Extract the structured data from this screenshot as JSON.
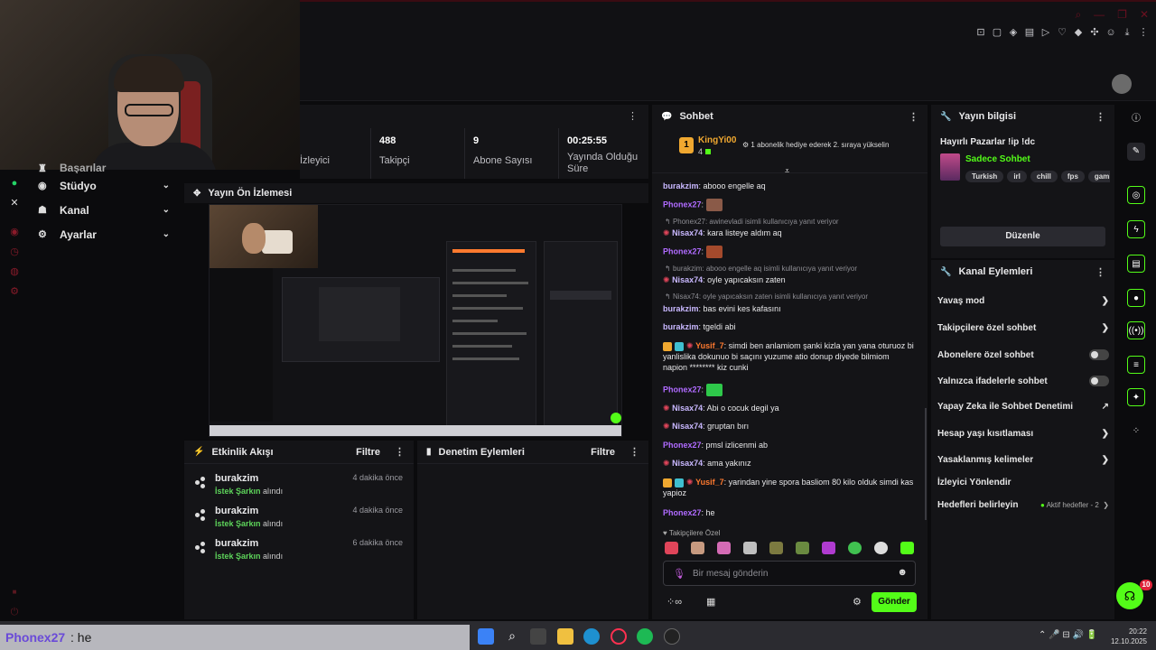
{
  "stats": [
    {
      "label": "İzleyici",
      "value": ""
    },
    {
      "label": "Takipçi",
      "value": "488"
    },
    {
      "label": "Abone Sayısı",
      "value": "9"
    },
    {
      "label": "Yayında Olduğu Süre",
      "value": "00:25:55"
    }
  ],
  "nav": {
    "partial_label": "Başarılar",
    "items": [
      {
        "label": "Stüdyo",
        "icon": "camera-icon"
      },
      {
        "label": "Kanal",
        "icon": "user-group-icon"
      },
      {
        "label": "Ayarlar",
        "icon": "gear-icon"
      }
    ]
  },
  "preview": {
    "title": "Yayın Ön İzlemesi"
  },
  "activity": {
    "title": "Etkinlik Akışı",
    "filter": "Filtre",
    "items": [
      {
        "user": "burakzim",
        "event": "İstek Şarkın",
        "suffix": "alındı",
        "time": "4 dakika önce"
      },
      {
        "user": "burakzim",
        "event": "İstek Şarkın",
        "suffix": "alındı",
        "time": "4 dakika önce"
      },
      {
        "user": "burakzim",
        "event": "İstek Şarkın",
        "suffix": "alındı",
        "time": "6 dakika önce"
      }
    ]
  },
  "moderation": {
    "title": "Denetim Eylemleri",
    "filter": "Filtre"
  },
  "chat": {
    "title": "Sohbet",
    "pinned": {
      "rank": "1",
      "user": "KingYi00",
      "count": "4",
      "text": "1 abonelik hediye ederek 2. sıraya yükselin"
    },
    "messages": [
      {
        "user": "burakzim",
        "color": "#c9b8ff",
        "text": "abooo engelle aq"
      },
      {
        "user": "Phonex27",
        "color": "#b06bff",
        "text": ""
      },
      {
        "reply": "Phonex27: awinevladi isimli kullanıcıya yanıt veriyor"
      },
      {
        "user": "Nisax74",
        "color": "#c9b8ff",
        "text": "kara listeye aldım aq"
      },
      {
        "user": "Phonex27",
        "color": "#b06bff",
        "text": ""
      },
      {
        "reply": "burakzim: abooo engelle aq isimli kullanıcıya yanıt veriyor"
      },
      {
        "user": "Nisax74",
        "color": "#c9b8ff",
        "text": "oyle yapıcaksın zaten"
      },
      {
        "reply": "Nisax74: oyle yapıcaksın zaten isimli kullanıcıya yanıt veriyor"
      },
      {
        "user": "burakzim",
        "color": "#c9b8ff",
        "text": "bas evini kes kafasını"
      },
      {
        "user": "burakzim",
        "color": "#c9b8ff",
        "text": "tgeldi abi"
      },
      {
        "user": "Yusif_7",
        "color": "#ff7a2f",
        "text": "simdi ben anlamiom şanki kizla yan yana oturuoz bi yanlislika dokunuo bi saçını yuzume atio donup diyede bilmiom napion ******** kiz cunki"
      },
      {
        "user": "Phonex27",
        "color": "#b06bff",
        "text": ""
      },
      {
        "user": "Nisax74",
        "color": "#c9b8ff",
        "text": "Abi o cocuk degil ya"
      },
      {
        "user": "Nisax74",
        "color": "#c9b8ff",
        "text": "gruptan bırı"
      },
      {
        "user": "Phonex27",
        "color": "#b06bff",
        "text": "pmsl izlicenmi ab"
      },
      {
        "user": "Nisax74",
        "color": "#c9b8ff",
        "text": "ama yakınız"
      },
      {
        "user": "Yusif_7",
        "color": "#ff7a2f",
        "text": "yarindan yine spora basliom 80 kilo olduk simdi kas yapioz"
      },
      {
        "user": "Phonex27",
        "color": "#b06bff",
        "text": "he"
      }
    ],
    "followers_only": "Takipçilere Özel",
    "input_placeholder": "Bir mesaj gönderin",
    "send": "Gönder"
  },
  "stream_info": {
    "title": "Yayın bilgisi",
    "stream_title": "Hayırlı Pazarlar !ip !dc",
    "category": "Sadece Sohbet",
    "tags": [
      "Turkish",
      "irl",
      "chill",
      "fps",
      "gaming"
    ],
    "edit": "Düzenle"
  },
  "channel_actions": {
    "title": "Kanal Eylemleri",
    "items": [
      {
        "label": "Yavaş mod",
        "control": "chevron"
      },
      {
        "label": "Takipçilere özel sohbet",
        "control": "chevron"
      },
      {
        "label": "Abonelere özel sohbet",
        "control": "toggle-off"
      },
      {
        "label": "Yalnızca ifadelerle sohbet",
        "control": "toggle-off"
      },
      {
        "label": "Yapay Zeka ile Sohbet Denetimi",
        "control": "external"
      },
      {
        "label": "Hesap yaşı kısıtlaması",
        "control": "chevron"
      },
      {
        "label": "Yasaklanmış kelimeler",
        "control": "chevron"
      },
      {
        "label": "İzleyici Yönlendir",
        "control": "none"
      },
      {
        "label": "Hedefleri belirleyin",
        "control": "chevron",
        "extra": "Aktif hedefler - 2"
      }
    ]
  },
  "support_badge": "10",
  "overlay": {
    "user": "Phonex27",
    "text": ": he"
  },
  "clock": {
    "time": "20:22",
    "date": "12.10.2025"
  },
  "colors": {
    "accent": "#53fc18",
    "panel": "#141417",
    "background": "#0b0b0d"
  }
}
